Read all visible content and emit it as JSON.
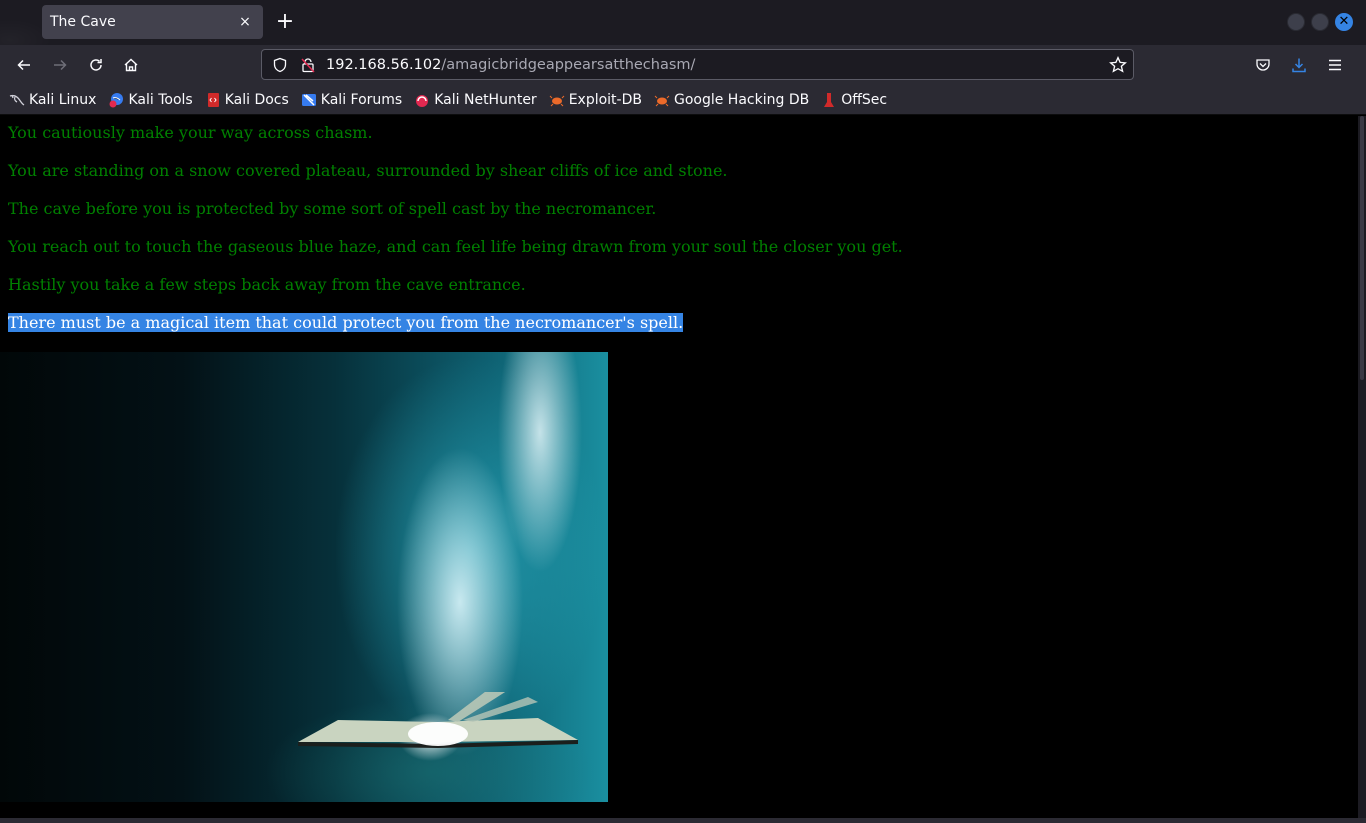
{
  "window": {
    "tab_title": "The Cave",
    "close_tab_icon": "×",
    "new_tab_icon": "+",
    "close_window_icon": "✕"
  },
  "navbar": {
    "url_host": "192.168.56.102",
    "url_path": "/amagicbridgeappearsatthechasm/"
  },
  "bookmarks": [
    {
      "label": "Kali Linux",
      "icon": "kali-dragon-icon"
    },
    {
      "label": "Kali Tools",
      "icon": "kali-tools-icon"
    },
    {
      "label": "Kali Docs",
      "icon": "kali-docs-icon"
    },
    {
      "label": "Kali Forums",
      "icon": "kali-forums-icon"
    },
    {
      "label": "Kali NetHunter",
      "icon": "kali-nethunter-icon"
    },
    {
      "label": "Exploit-DB",
      "icon": "exploit-db-icon"
    },
    {
      "label": "Google Hacking DB",
      "icon": "ghdb-icon"
    },
    {
      "label": "OffSec",
      "icon": "offsec-icon"
    }
  ],
  "story": {
    "lines": [
      "You cautiously make your way across chasm.",
      "You are standing on a snow covered plateau, surrounded by shear cliffs of ice and stone.",
      "The cave before you is protected by some sort of spell cast by the necromancer.",
      "You reach out to touch the gaseous blue haze, and can feel life being drawn from your soul the closer you get.",
      "Hastily you take a few steps back away from the cave entrance.",
      "There must be a magical item that could protect you from the necromancer's spell."
    ],
    "selected_line_index": 5
  },
  "colors": {
    "story_text": "#008000",
    "selection_bg": "#3584e4",
    "accent_blue": "#3584e4"
  },
  "image": {
    "description": "Glowing open magic book emitting bright blue-white light"
  }
}
